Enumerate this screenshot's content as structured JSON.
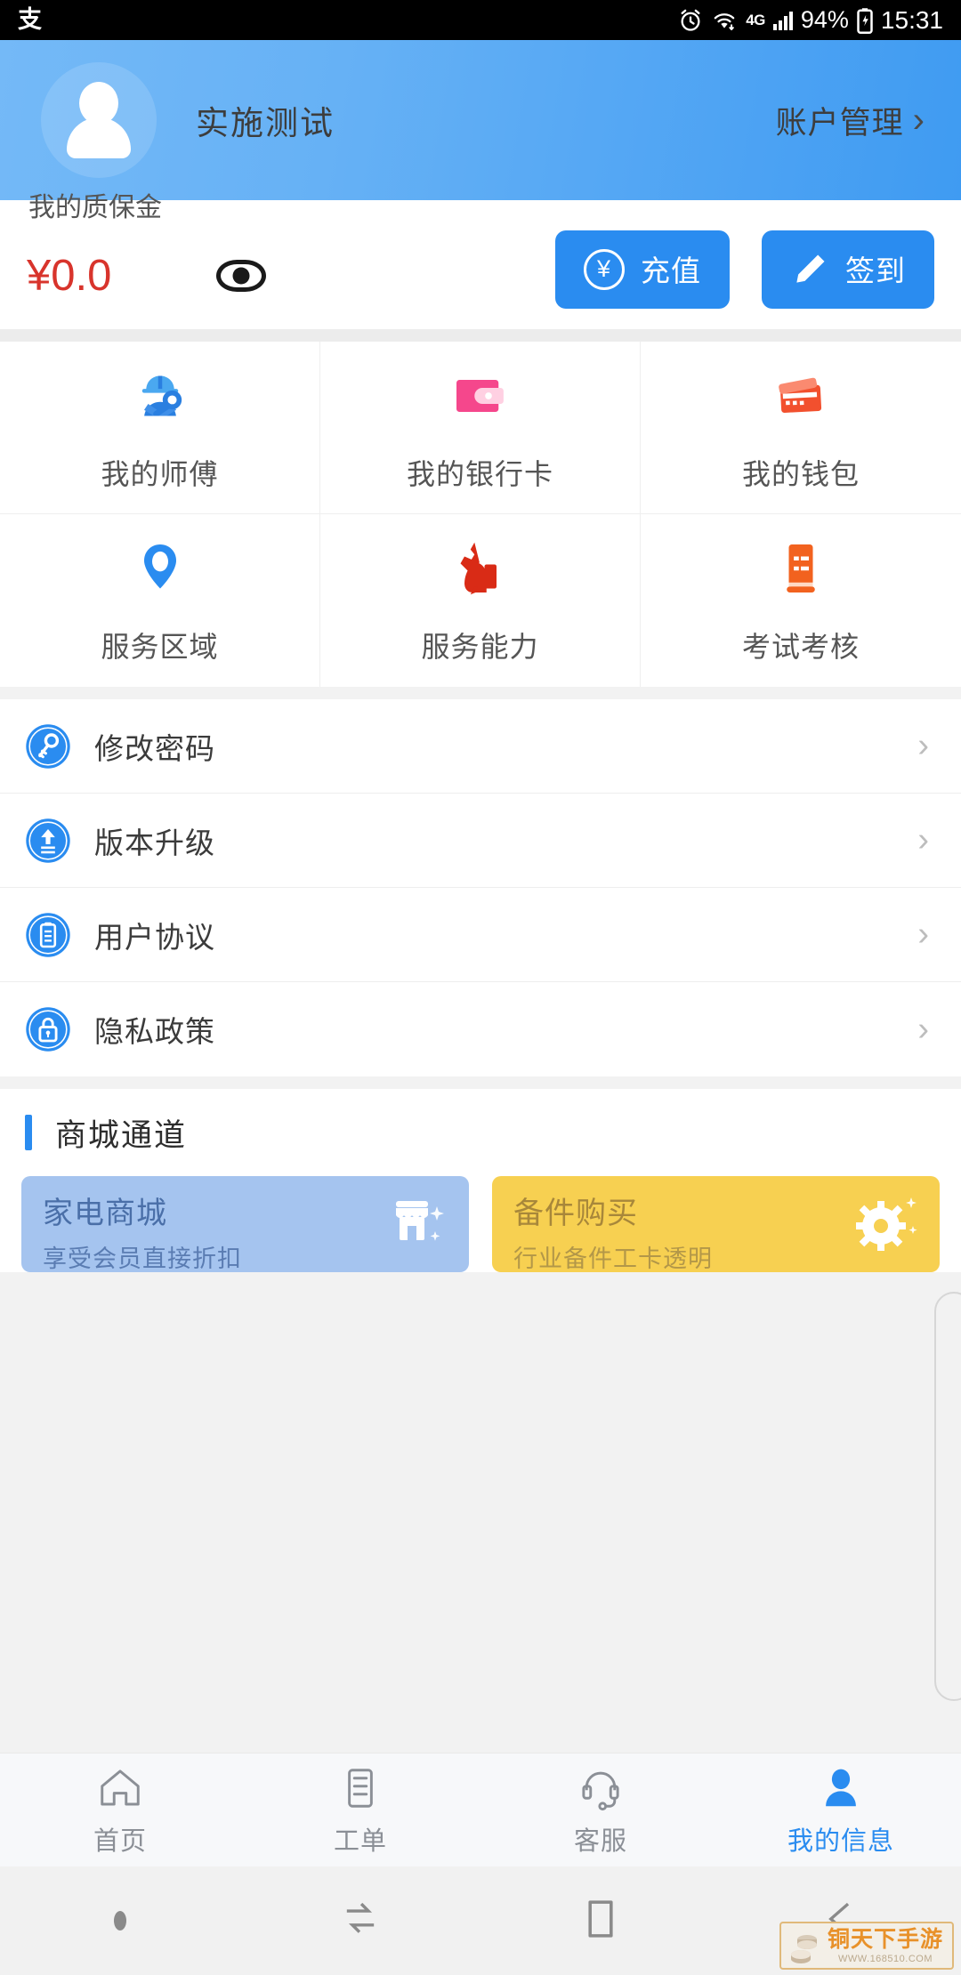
{
  "status_bar": {
    "left_icon": "alipay-icon",
    "alarm_icon": "alarm-icon",
    "wifi_icon": "wifi-icon",
    "network": "4G",
    "signal_icon": "signal-bars-icon",
    "battery_percent": "94%",
    "battery_icon": "battery-charging-icon",
    "time": "15:31"
  },
  "profile": {
    "avatar_icon": "avatar-person-icon",
    "name": "实施测试",
    "account_link": "账户管理",
    "chevron": "›"
  },
  "balance": {
    "label": "我的质保金",
    "amount": "¥0.0",
    "eye_icon": "eye-icon",
    "recharge_label": "充值",
    "recharge_icon": "yuan-circle-icon",
    "signin_label": "签到",
    "signin_icon": "pencil-icon"
  },
  "grid": {
    "items": [
      {
        "label": "我的师傅",
        "icon": "worker-helmet-wrench-icon",
        "color": "#2a7fe0"
      },
      {
        "label": "我的银行卡",
        "icon": "wallet-icon",
        "color": "#f5478c"
      },
      {
        "label": "我的钱包",
        "icon": "cards-icon",
        "color": "#f2502e"
      },
      {
        "label": "服务区域",
        "icon": "map-pin-icon",
        "color": "#2a8cf0"
      },
      {
        "label": "服务能力",
        "icon": "wrench-hand-icon",
        "color": "#d92b16"
      },
      {
        "label": "考试考核",
        "icon": "scroll-document-icon",
        "color": "#f2621f"
      }
    ]
  },
  "settings": {
    "rows": [
      {
        "label": "修改密码",
        "icon": "key-circle-icon",
        "chevron": "›"
      },
      {
        "label": "版本升级",
        "icon": "upload-circle-icon",
        "chevron": "›"
      },
      {
        "label": "用户协议",
        "icon": "document-circle-icon",
        "chevron": "›"
      },
      {
        "label": "隐私政策",
        "icon": "lock-circle-icon",
        "chevron": "›"
      }
    ]
  },
  "mall": {
    "title": "商城通道",
    "cards": [
      {
        "title": "家电商城",
        "subtitle": "享受会员直接折扣",
        "icon": "shop-icon",
        "bg": "#a5c4ef"
      },
      {
        "title": "备件购买",
        "subtitle": "行业备件工卡透明",
        "icon": "gear-icon",
        "bg": "#f7d051"
      }
    ]
  },
  "tabbar": {
    "tabs": [
      {
        "label": "首页",
        "icon": "home-icon",
        "active": false
      },
      {
        "label": "工单",
        "icon": "order-icon",
        "active": false
      },
      {
        "label": "客服",
        "icon": "headset-icon",
        "active": false
      },
      {
        "label": "我的信息",
        "icon": "person-icon",
        "active": true
      }
    ],
    "active_color": "#2a8cf0",
    "inactive_color": "#8b8f96"
  },
  "android_nav": {
    "items": [
      "dot-indicator",
      "recents-icon",
      "home-square-icon",
      "back-icon"
    ]
  },
  "watermark": {
    "name": "铜天下手游",
    "url": "WWW.168510.COM",
    "icon": "coins-icon"
  },
  "colors": {
    "accent": "#2a8cf0",
    "header_gradient_from": "#74b9f7",
    "header_gradient_to": "#3f9bf2",
    "amount_red": "#d8342c",
    "band_gray": "#ececec"
  }
}
